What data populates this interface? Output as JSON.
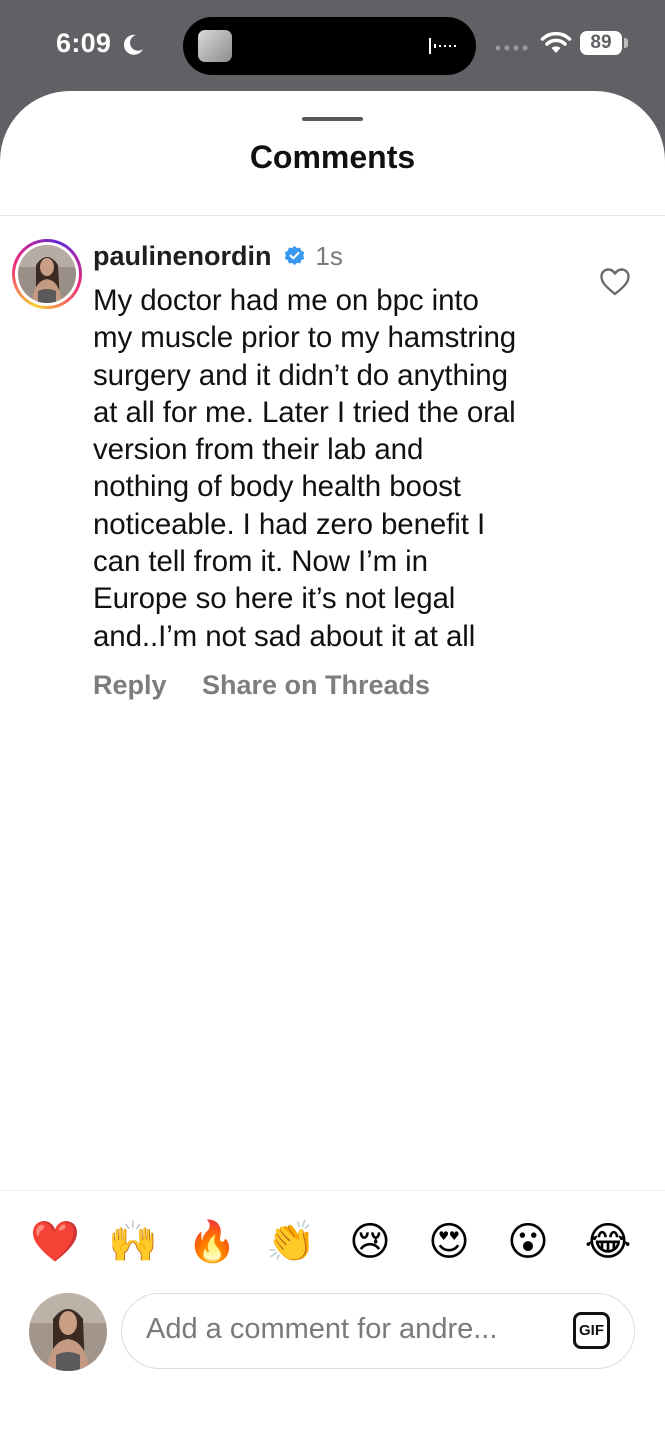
{
  "status_bar": {
    "time": "6:09",
    "battery": "89",
    "icons": [
      "moon-icon",
      "audio-waveform-icon",
      "cellular-signal-icon",
      "wifi-icon",
      "battery-icon"
    ]
  },
  "sheet": {
    "title": "Comments"
  },
  "comment": {
    "username": "paulinenordin",
    "verified": true,
    "time": "1s",
    "lines": [
      "My doctor had me on bpc into",
      "my muscle prior to my hamstring",
      "surgery and it didn’t do anything",
      "at all for me. Later I tried the oral",
      "version from their lab and",
      "nothing of body health boost",
      "noticeable. I had zero benefit I",
      "can tell from it. Now I’m in",
      "Europe so here it’s not legal",
      "and..I’m not sad about it at all"
    ],
    "reply_label": "Reply",
    "share_label": "Share on Threads",
    "like_icon": "heart-outline-icon"
  },
  "composer": {
    "emojis": [
      "❤️",
      "🙌",
      "🔥",
      "👏",
      "😢",
      "😍",
      "😮",
      "😂"
    ],
    "placeholder": "Add a comment for andre...",
    "gif_label": "GIF"
  },
  "colors": {
    "status_bar_bg": "#5f6165",
    "verified_blue": "#3897f0",
    "secondary_text": "#7d7d80"
  }
}
